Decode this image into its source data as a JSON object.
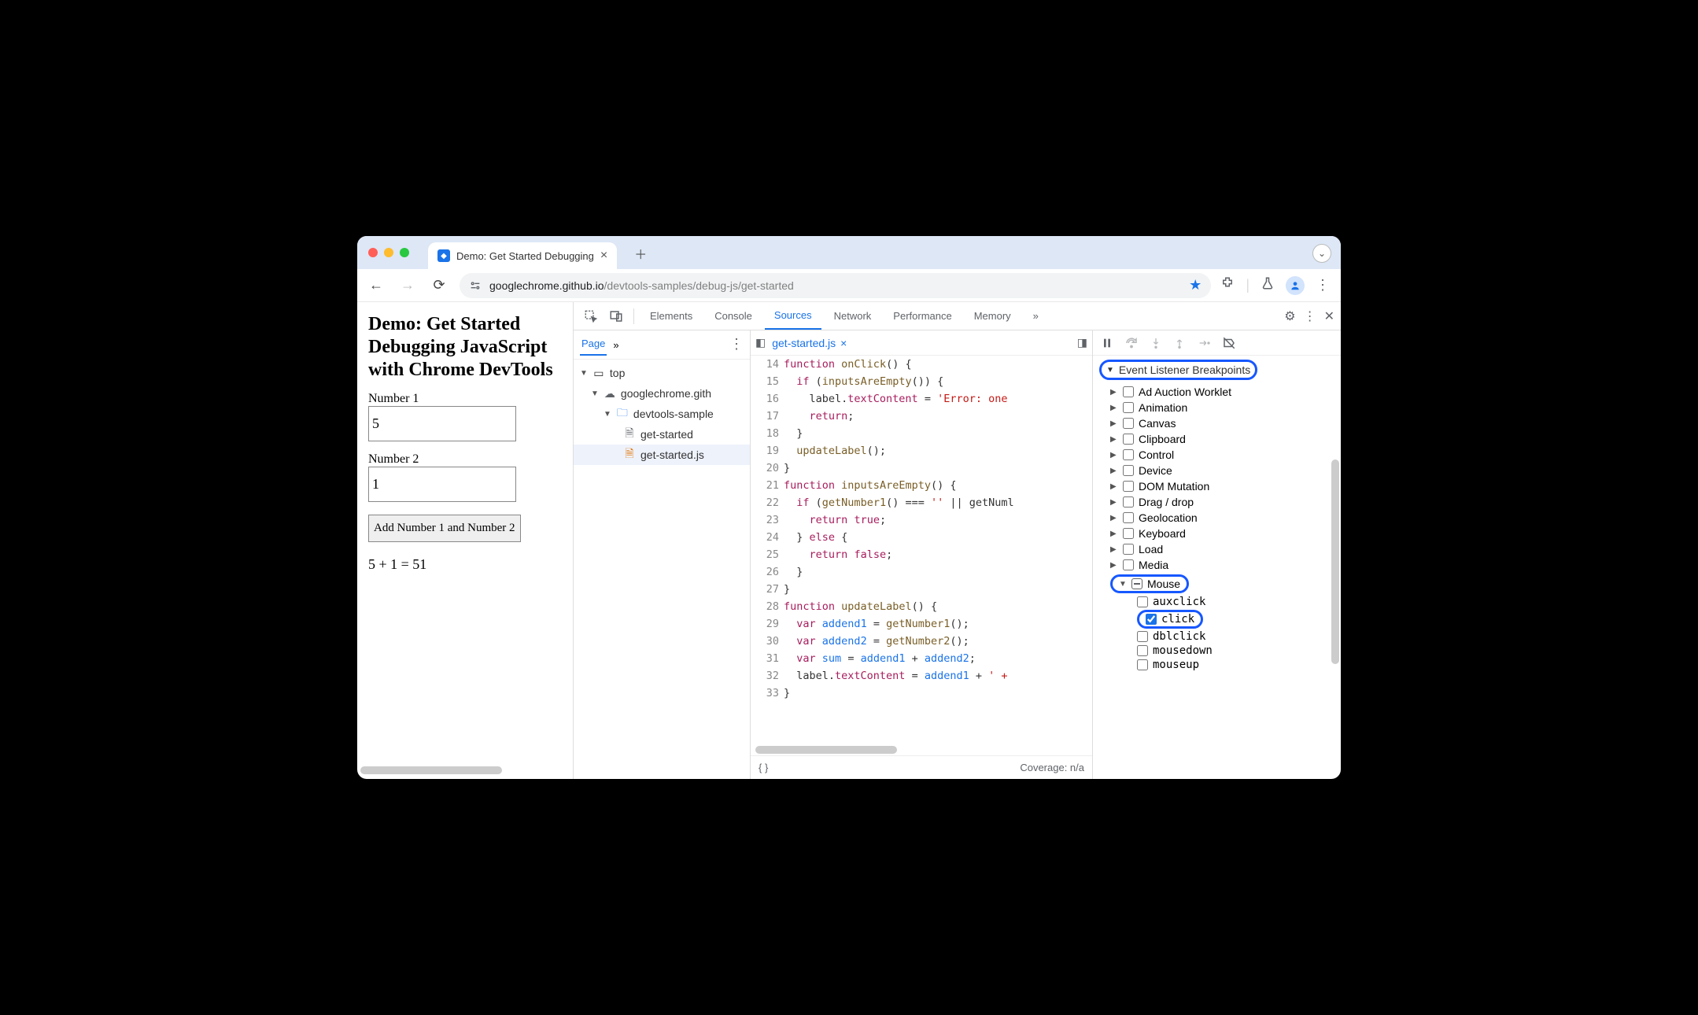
{
  "browser": {
    "tab_title": "Demo: Get Started Debugging",
    "url_domain": "googlechrome.github.io",
    "url_path": "/devtools-samples/debug-js/get-started"
  },
  "page": {
    "heading": "Demo: Get Started Debugging JavaScript with Chrome DevTools",
    "label1": "Number 1",
    "value1": "5",
    "label2": "Number 2",
    "value2": "1",
    "button": "Add Number 1 and Number 2",
    "answer": "5 + 1 = 51"
  },
  "devtools": {
    "tabs": [
      "Elements",
      "Console",
      "Sources",
      "Network",
      "Performance",
      "Memory"
    ],
    "active_tab": "Sources",
    "navigator_tab": "Page",
    "tree": {
      "top": "top",
      "origin": "googlechrome.gith",
      "folder": "devtools-sample",
      "file_html": "get-started",
      "file_js": "get-started.js"
    },
    "open_file": "get-started.js",
    "first_line_no": 14,
    "last_line_no": 33,
    "lines": [
      "function onClick() {",
      "  if (inputsAreEmpty()) {",
      "    label.textContent = 'Error: one",
      "    return;",
      "  }",
      "  updateLabel();",
      "}",
      "function inputsAreEmpty() {",
      "  if (getNumber1() === '' || getNuml",
      "    return true;",
      "  } else {",
      "    return false;",
      "  }",
      "}",
      "function updateLabel() {",
      "  var addend1 = getNumber1();",
      "  var addend2 = getNumber2();",
      "  var sum = addend1 + addend2;",
      "  label.textContent = addend1 + ' +",
      "}"
    ],
    "coverage": "Coverage: n/a",
    "event_section": "Event Listener Breakpoints",
    "categories": [
      "Ad Auction Worklet",
      "Animation",
      "Canvas",
      "Clipboard",
      "Control",
      "Device",
      "DOM Mutation",
      "Drag / drop",
      "Geolocation",
      "Keyboard",
      "Load",
      "Media",
      "Mouse"
    ],
    "mouse_events": [
      "auxclick",
      "click",
      "dblclick",
      "mousedown",
      "mouseup"
    ],
    "mouse_checked": "click"
  }
}
